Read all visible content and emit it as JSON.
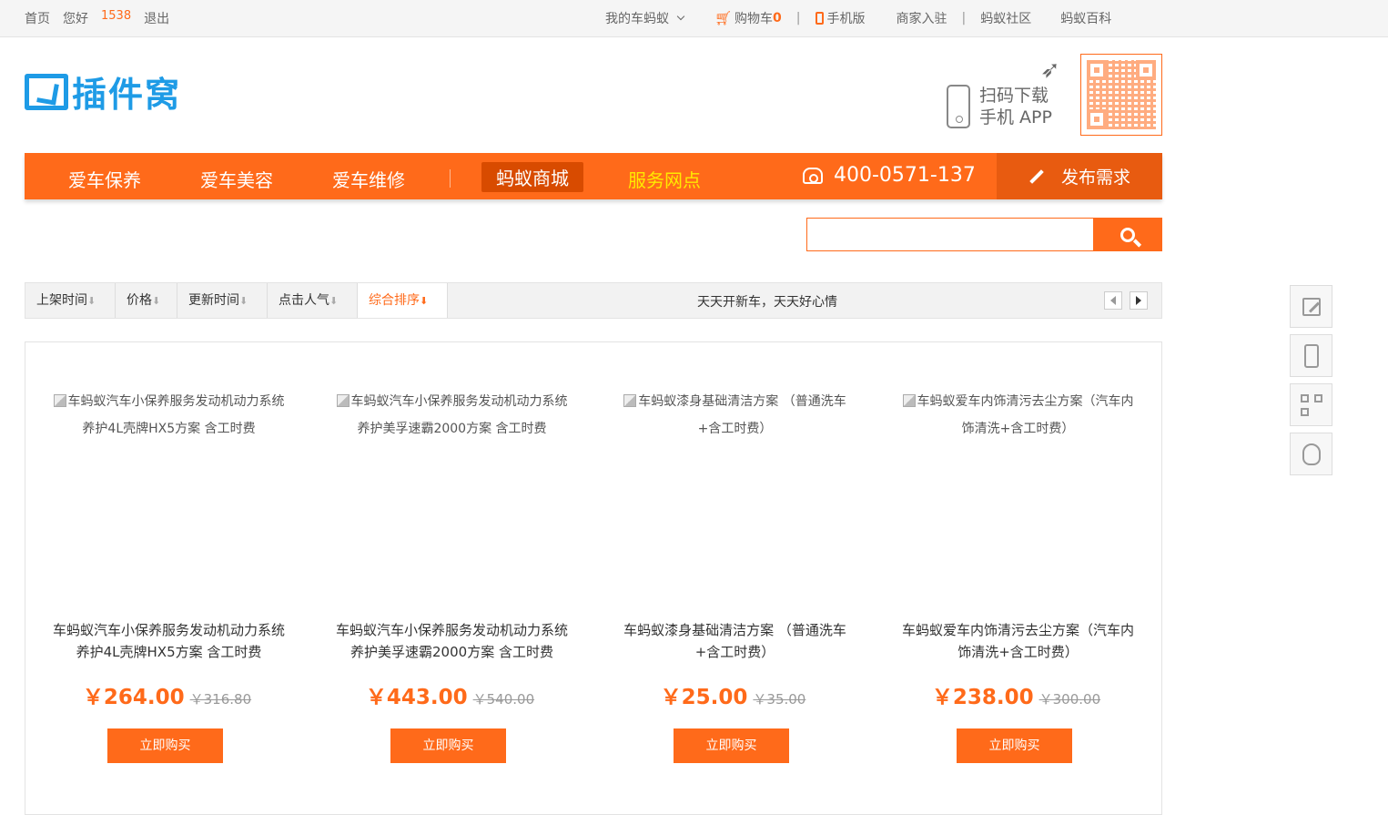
{
  "topbar": {
    "home": "首页",
    "greeting": "您好",
    "user": "1538",
    "logout": "退出",
    "my": "我的车蚂蚁",
    "cart": "购物车",
    "cart_count": "0",
    "mobile": "手机版",
    "merchant": "商家入驻",
    "community": "蚂蚁社区",
    "wiki": "蚂蚁百科"
  },
  "header": {
    "logo_text": "插件窝",
    "app_line1": "扫码下载",
    "app_line2": "手机 APP"
  },
  "nav": {
    "items": [
      "爱车保养",
      "爱车美容",
      "爱车维修",
      "蚂蚁商城",
      "服务网点"
    ],
    "active": "蚂蚁商城",
    "phone": "400-0571-137",
    "publish": "发布需求",
    "accent": "#ff6a1a"
  },
  "search": {
    "placeholder": ""
  },
  "sortbar": {
    "items": [
      "上架时间",
      "价格",
      "更新时间",
      "点击人气",
      "综合排序"
    ],
    "active": "综合排序",
    "slogan": "天天开新车，天天好心情"
  },
  "products": [
    {
      "img_alt": "车蚂蚁汽车小保养服务发动机动力系统养护4L壳牌HX5方案 含工时费",
      "title": "车蚂蚁汽车小保养服务发动机动力系统养护4L壳牌HX5方案 含工时费",
      "price": "￥264.00",
      "old_price": "￥316.80",
      "buy": "立即购买"
    },
    {
      "img_alt": "车蚂蚁汽车小保养服务发动机动力系统养护美孚速霸2000方案 含工时费",
      "title": "车蚂蚁汽车小保养服务发动机动力系统养护美孚速霸2000方案 含工时费",
      "price": "￥443.00",
      "old_price": "￥540.00",
      "buy": "立即购买"
    },
    {
      "img_alt": "车蚂蚁漆身基础清洁方案 （普通洗车+含工时费）",
      "title": "车蚂蚁漆身基础清洁方案 （普通洗车+含工时费）",
      "price": "￥25.00",
      "old_price": "￥35.00",
      "buy": "立即购买"
    },
    {
      "img_alt": "车蚂蚁爱车内饰清污去尘方案（汽车内饰清洗+含工时费）",
      "title": "车蚂蚁爱车内饰清污去尘方案（汽车内饰清洗+含工时费）",
      "price": "￥238.00",
      "old_price": "￥300.00",
      "buy": "立即购买"
    }
  ],
  "side_tools": [
    "edit-icon",
    "phone-icon",
    "qr-icon",
    "qq-icon"
  ]
}
